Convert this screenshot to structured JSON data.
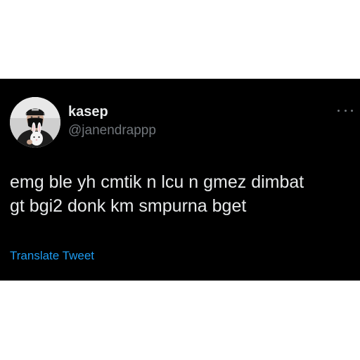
{
  "tweet": {
    "display_name": "kasep",
    "handle": "@janendrappp",
    "text_lines": [
      "emg ble yh cmtik n lcu n gmez dimbat",
      "gt bgi2 donk km smpurna bget"
    ],
    "translate_label": "Translate Tweet",
    "more_icon": "more-horizontal-icon",
    "avatar_icon": "profile-photo"
  },
  "colors": {
    "page_background": "#ffffff",
    "tweet_background": "#000000",
    "primary_text": "#e7e9ea",
    "secondary_text": "#71767b",
    "link": "#1d9bf0"
  }
}
